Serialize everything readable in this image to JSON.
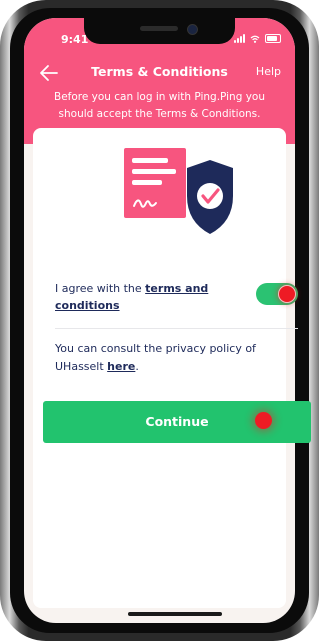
{
  "status_bar": {
    "time": "9:41"
  },
  "header": {
    "title": "Terms & Conditions",
    "help_label": "Help",
    "intro_line1": "Before you can log in with Ping.Ping you",
    "intro_line2": "should accept the Terms & Conditions."
  },
  "agree": {
    "prefix": "I agree with the ",
    "link_part1": "terms and",
    "link_part2": "conditions",
    "toggle_on": true
  },
  "privacy": {
    "text_part1": "You can consult the privacy policy of",
    "text_part2": "UHasselt ",
    "link": "here",
    "suffix": "."
  },
  "continue_label": "Continue",
  "colors": {
    "header": "#f7557f",
    "accent_green": "#22c36e",
    "text_navy": "#1e2a5a",
    "tap_marker": "#ee1b24"
  },
  "icons": [
    "back-arrow-icon",
    "document-icon",
    "shield-check-icon",
    "signal-icon",
    "wifi-icon",
    "battery-icon"
  ]
}
